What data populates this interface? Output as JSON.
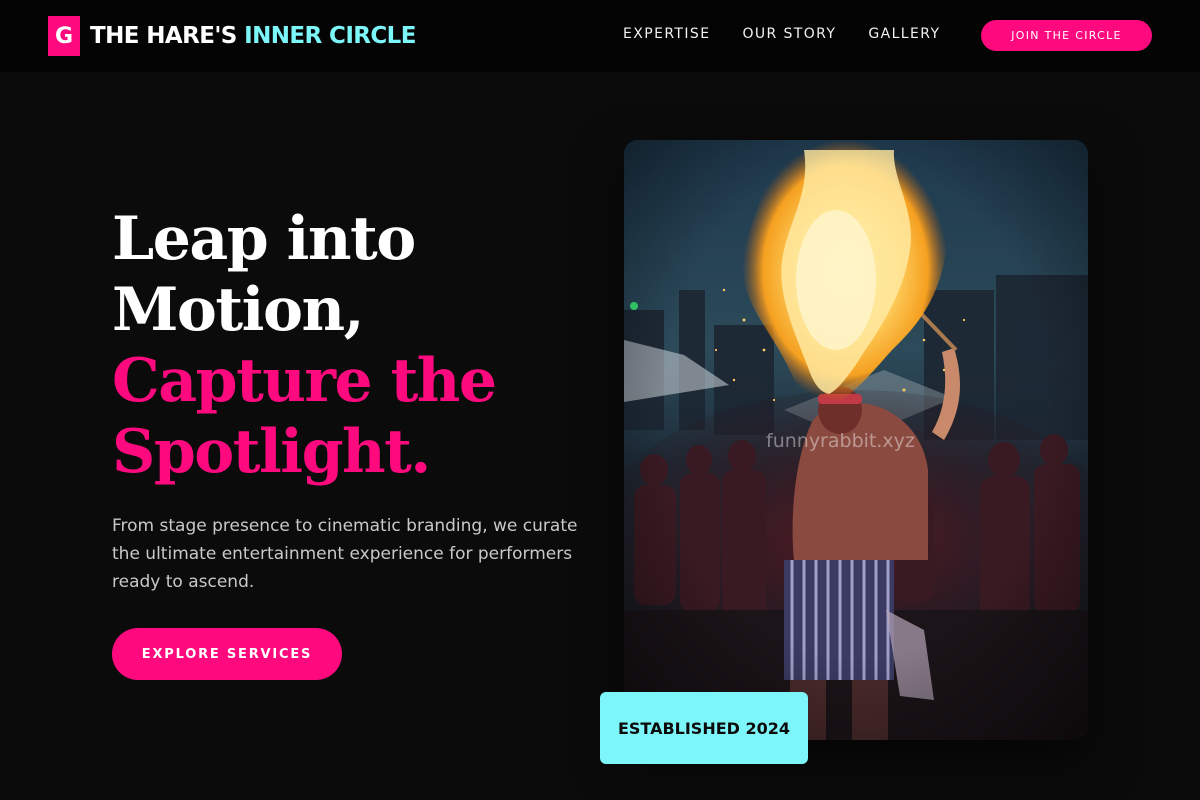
{
  "brand": {
    "mark": "G",
    "name_primary": "THE HARE'S",
    "name_accent": "INNER CIRCLE"
  },
  "nav": {
    "links": [
      {
        "label": "EXPERTISE"
      },
      {
        "label": "OUR STORY"
      },
      {
        "label": "GALLERY"
      }
    ],
    "cta_label": "JOIN THE CIRCLE"
  },
  "hero": {
    "title_lines": [
      "Leap into",
      "Motion,"
    ],
    "title_accent_lines": [
      "Capture the",
      "Spotlight."
    ],
    "description": "From stage presence to cinematic branding, we curate the ultimate entertainment experience for performers ready to ascend.",
    "cta_label": "EXPLORE SERVICES"
  },
  "photo": {
    "subject": "fire-breather-performer-photo",
    "watermark": "funnyrabbit.xyz"
  },
  "badge": {
    "label": "ESTABLISHED 2024"
  },
  "colors": {
    "accent_pink": "#ff0a7e",
    "accent_cyan": "#7df6f9",
    "background": "#0b0b0c",
    "topbar": "#040404"
  }
}
